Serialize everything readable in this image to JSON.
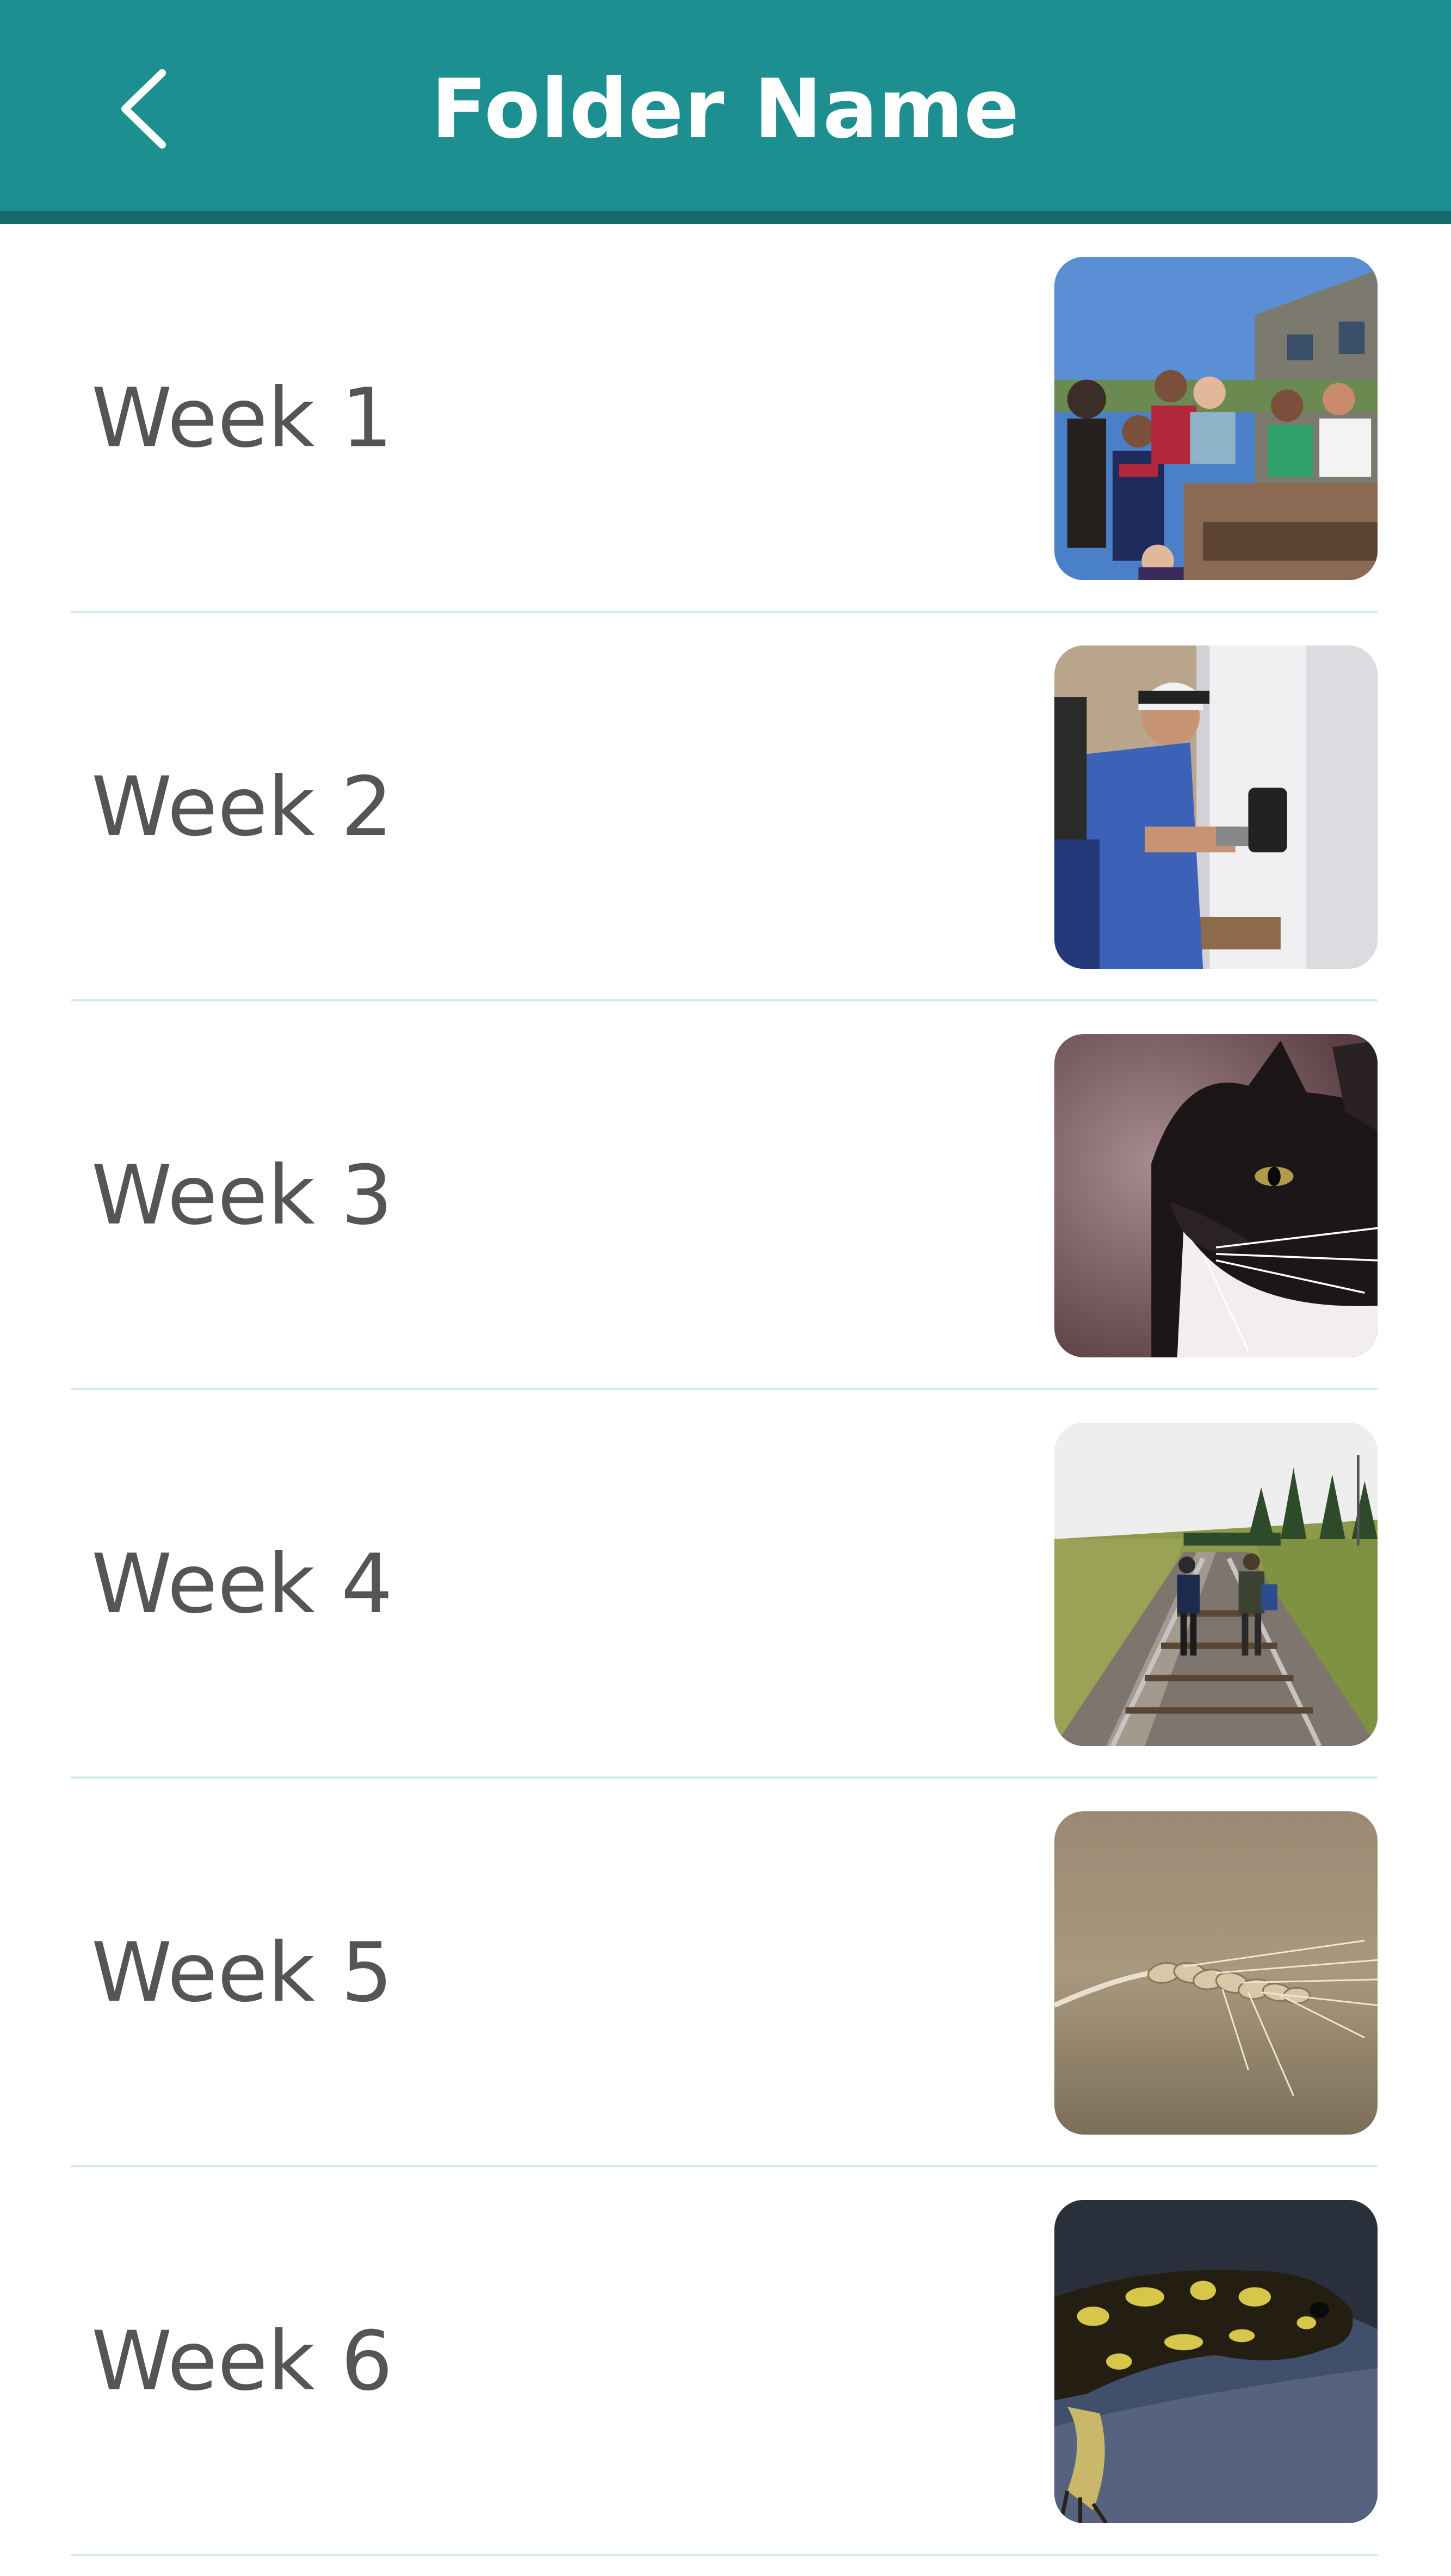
{
  "header": {
    "title": "Folder Name",
    "back_icon": "chevron-left-icon",
    "background_color": "#1d8f90",
    "border_color": "#156a6a",
    "title_color": "#ffffff"
  },
  "weeks": [
    {
      "label": "Week 1",
      "thumbnail": "group-photo-outdoors"
    },
    {
      "label": "Week 2",
      "thumbnail": "person-painting-wall"
    },
    {
      "label": "Week 3",
      "thumbnail": "black-and-white-cat"
    },
    {
      "label": "Week 4",
      "thumbnail": "people-walking-railroad-tracks"
    },
    {
      "label": "Week 5",
      "thumbnail": "wheat-stalk"
    },
    {
      "label": "Week 6",
      "thumbnail": "salamander-on-rock"
    }
  ],
  "colors": {
    "label_text": "#555555",
    "divider": "#d4ebea"
  }
}
